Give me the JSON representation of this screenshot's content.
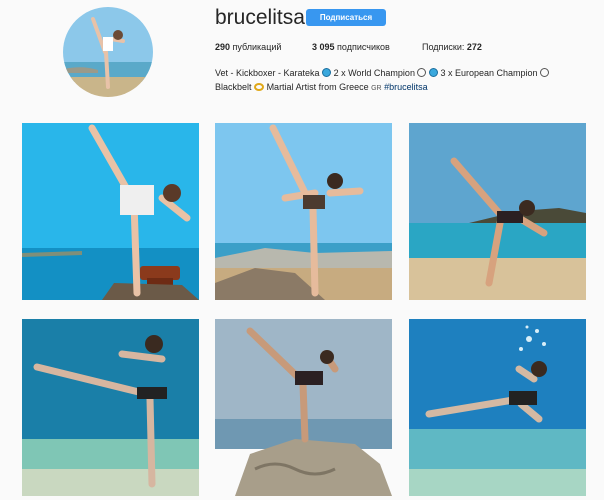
{
  "profile": {
    "username": "brucelitsa",
    "follow_label": "Подписаться",
    "stats": {
      "posts_count": "290",
      "posts_label": "публикаций",
      "followers_count": "3 095",
      "followers_label": "подписчиков",
      "following_label": "Подписки:",
      "following_count": "272"
    },
    "bio": {
      "part1": "Vet - Kickboxer - Karateka",
      "part2": "2 x World Champion",
      "part3": "3 x European Champion",
      "part4": "Blackbelt",
      "part5": "Martial Artist from Greece",
      "flag": "GR",
      "hashtag": "#brucelitsa"
    }
  },
  "posts": [
    {
      "scene": "sea-rock-kick"
    },
    {
      "scene": "beach-high-kick"
    },
    {
      "scene": "shore-side-kick"
    },
    {
      "scene": "underwater-kick"
    },
    {
      "scene": "rocks-kick"
    },
    {
      "scene": "underwater-bubbles-kick"
    }
  ],
  "colors": {
    "follow_button": "#3897f0",
    "hashtag": "#003569",
    "background": "#fafafa"
  }
}
